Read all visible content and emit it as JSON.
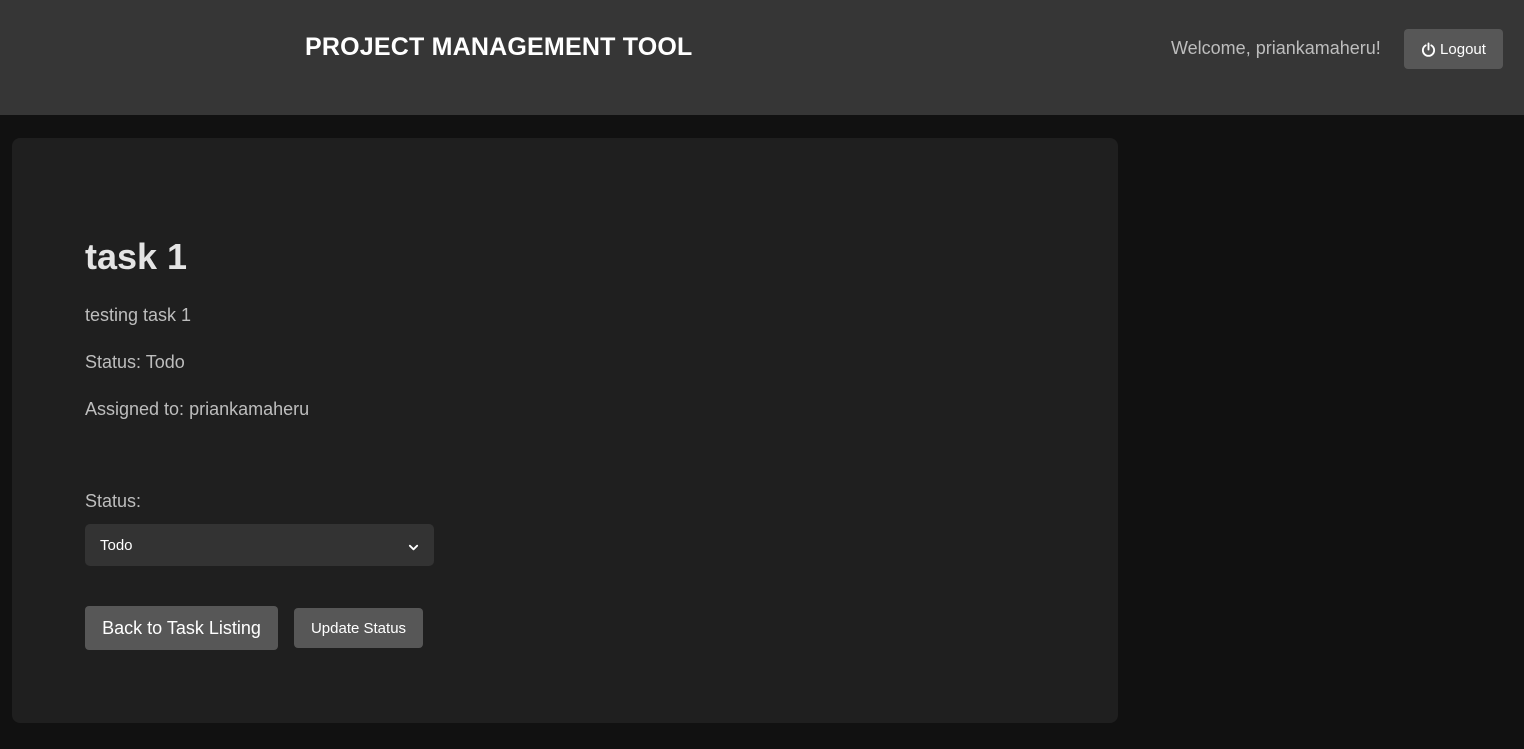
{
  "header": {
    "app_title": "PROJECT MANAGEMENT TOOL",
    "welcome_text": "Welcome, priankamaheru!",
    "logout_label": "Logout",
    "logout_icon": "power-icon"
  },
  "task": {
    "title": "task 1",
    "description": "testing task 1",
    "status_text": "Status: Todo",
    "assigned_text": "Assigned to: priankamaheru"
  },
  "status_form": {
    "label": "Status:",
    "selected": "Todo",
    "dropdown_icon": "chevron-down-icon"
  },
  "actions": {
    "back_label": "Back to Task Listing",
    "update_label": "Update Status"
  },
  "colors": {
    "page_bg": "#111111",
    "header_bg": "#363636",
    "card_bg": "#1f1f1f",
    "button_bg": "#575757",
    "select_bg": "#333333"
  }
}
